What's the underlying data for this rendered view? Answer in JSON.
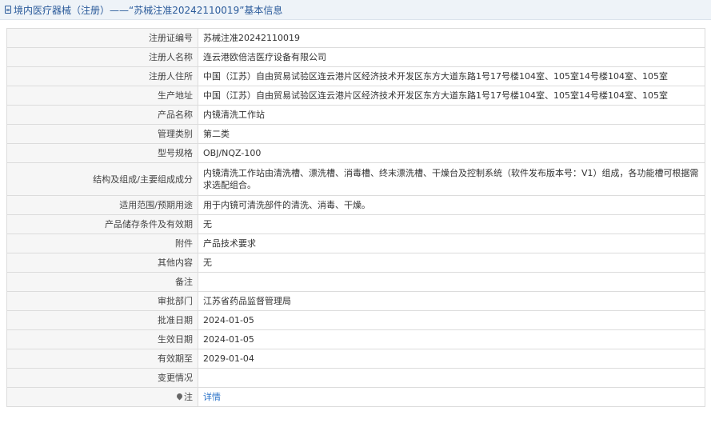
{
  "header": {
    "title": "境内医疗器械（注册）——“苏械注准20242110019”基本信息",
    "icon": "document-icon"
  },
  "rows": [
    {
      "label": "注册证编号",
      "value": "苏械注准20242110019"
    },
    {
      "label": "注册人名称",
      "value": "连云港欧倍洁医疗设备有限公司"
    },
    {
      "label": "注册人住所",
      "value": "中国（江苏）自由贸易试验区连云港片区经济技术开发区东方大道东路1号17号楼104室、105室14号楼104室、105室"
    },
    {
      "label": "生产地址",
      "value": "中国（江苏）自由贸易试验区连云港片区经济技术开发区东方大道东路1号17号楼104室、105室14号楼104室、105室"
    },
    {
      "label": "产品名称",
      "value": "内镜清洗工作站"
    },
    {
      "label": "管理类别",
      "value": "第二类"
    },
    {
      "label": "型号规格",
      "value": "OBJ/NQZ-100"
    },
    {
      "label": "结构及组成/主要组成成分",
      "value": "内镜清洗工作站由清洗槽、漂洗槽、消毒槽、终末漂洗槽、干燥台及控制系统（软件发布版本号：V1）组成，各功能槽可根据需求选配组合。"
    },
    {
      "label": "适用范围/预期用途",
      "value": "用于内镜可清洗部件的清洗、消毒、干燥。"
    },
    {
      "label": "产品储存条件及有效期",
      "value": "无"
    },
    {
      "label": "附件",
      "value": "产品技术要求"
    },
    {
      "label": "其他内容",
      "value": "无"
    },
    {
      "label": "备注",
      "value": ""
    },
    {
      "label": "审批部门",
      "value": "江苏省药品监督管理局"
    },
    {
      "label": "批准日期",
      "value": "2024-01-05"
    },
    {
      "label": "生效日期",
      "value": "2024-01-05"
    },
    {
      "label": "有效期至",
      "value": "2029-01-04"
    },
    {
      "label": "变更情况",
      "value": ""
    }
  ],
  "note": {
    "label": "注",
    "link": "详情",
    "icon": "pin-icon"
  },
  "colors": {
    "header_bg": "#eef3f8",
    "header_text": "#2a5a9a",
    "label_bg": "#f6f6f6",
    "border": "#dcdcdc",
    "link": "#2a72c8"
  }
}
